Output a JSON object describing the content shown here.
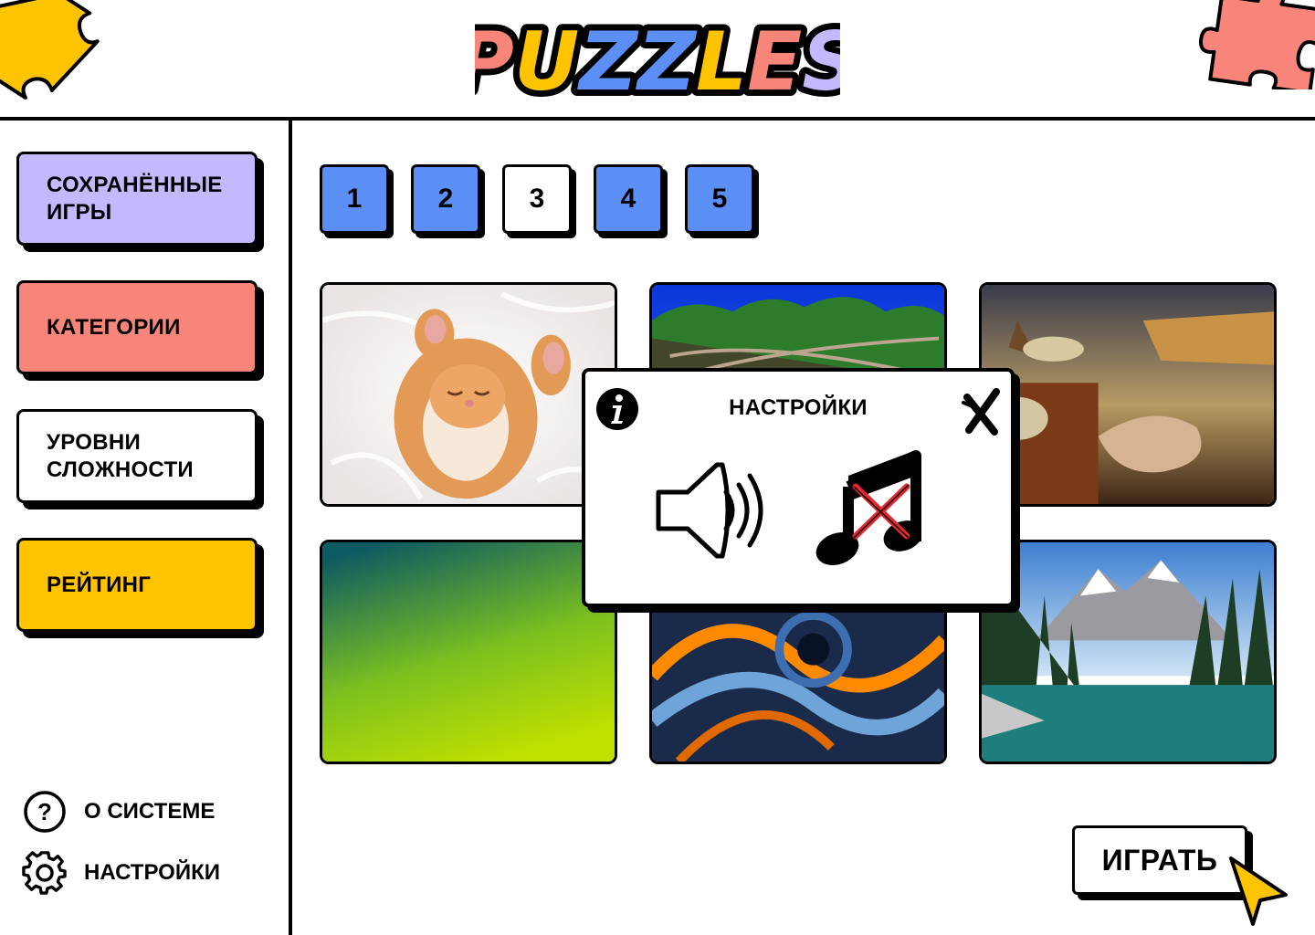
{
  "header": {
    "logo_text": "PUZZLES",
    "logo_letter_colors": [
      "#f8857a",
      "#ffc400",
      "#5b8ff5",
      "#5b8ff5",
      "#ffc400",
      "#f8857a",
      "#c4b9ff"
    ]
  },
  "sidebar": {
    "items": [
      {
        "label": "СОХРАНЁННЫЕ ИГРЫ",
        "color": "#c4b9ff"
      },
      {
        "label": "КАТЕГОРИИ",
        "color": "#f8857a"
      },
      {
        "label": "УРОВНИ СЛОЖНОСТИ",
        "color": "#ffffff"
      },
      {
        "label": "РЕЙТИНГ",
        "color": "#ffc400"
      }
    ],
    "about_label": "О СИСТЕМЕ",
    "settings_label": "НАСТРОЙКИ"
  },
  "pagination": {
    "pages": [
      "1",
      "2",
      "3",
      "4",
      "5"
    ],
    "active": "3",
    "color": "#5b8ff5"
  },
  "gallery": {
    "tiles": [
      {
        "subject": "kitten"
      },
      {
        "subject": "trees-blue-sky"
      },
      {
        "subject": "melting-clocks-painting"
      },
      {
        "subject": "green-gradient"
      },
      {
        "subject": "abstract-fractal"
      },
      {
        "subject": "mountain-lake-forest"
      }
    ]
  },
  "play_button": {
    "label": "ИГРАТЬ"
  },
  "modal": {
    "title": "НАСТРОЙКИ",
    "info_icon": "info-icon",
    "close_icon": "close-icon",
    "sound": {
      "icon": "speaker-icon",
      "enabled": true
    },
    "music": {
      "icon": "music-note-icon",
      "enabled": false
    }
  }
}
